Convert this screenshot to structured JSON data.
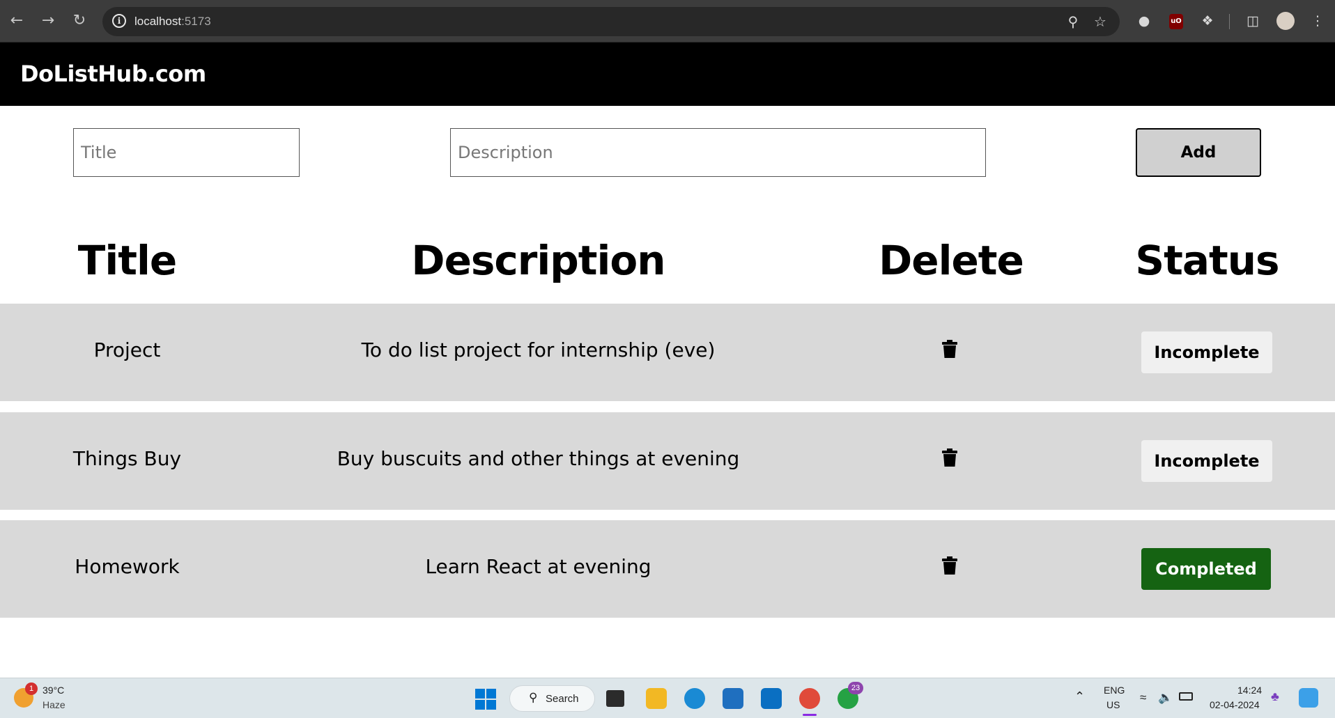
{
  "browser": {
    "url_host": "localhost",
    "url_port": ":5173"
  },
  "app": {
    "brand": "DoListHub.com"
  },
  "form": {
    "title_placeholder": "Title",
    "description_placeholder": "Description",
    "add_label": "Add"
  },
  "table": {
    "headers": {
      "title": "Title",
      "description": "Description",
      "delete": "Delete",
      "status": "Status"
    },
    "rows": [
      {
        "title": "Project",
        "description": "To do list project for internship (eve)",
        "status": "Incomplete"
      },
      {
        "title": "Things Buy",
        "description": "Buy buscuits and other things at evening",
        "status": "Incomplete"
      },
      {
        "title": "Homework",
        "description": "Learn React at evening",
        "status": "Completed"
      }
    ]
  },
  "taskbar": {
    "weather_badge": "1",
    "weather_temp": "39°C",
    "weather_condition": "Haze",
    "search_label": "Search",
    "whatsapp_badge": "23",
    "lang_top": "ENG",
    "lang_bottom": "US",
    "time": "14:24",
    "date": "02-04-2024"
  },
  "colors": {
    "header_bg": "#000000",
    "row_bg": "#d9d9d9",
    "completed_bg": "#156312",
    "incomplete_bg": "#f0f0f0"
  }
}
